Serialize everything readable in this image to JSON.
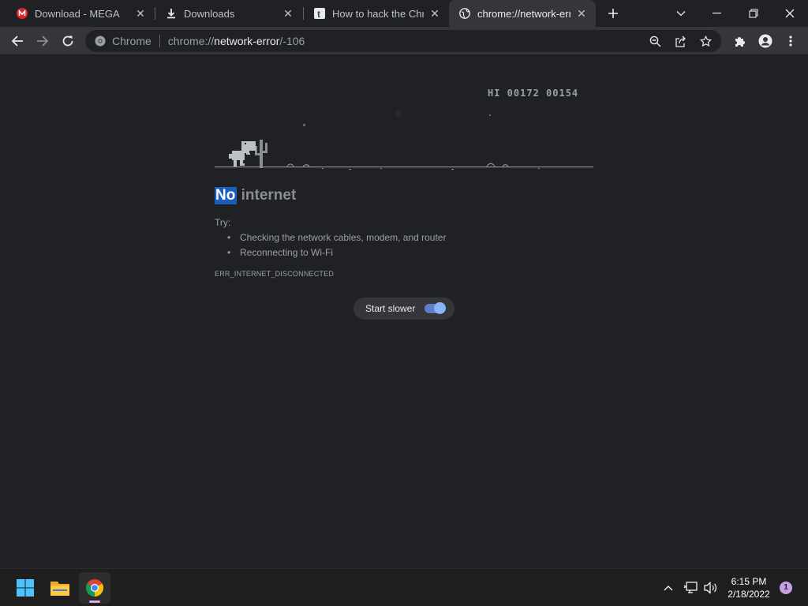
{
  "tabs": [
    {
      "title": "Download - MEGA",
      "favicon": "mega-icon"
    },
    {
      "title": "Downloads",
      "favicon": "download-icon"
    },
    {
      "title": "How to hack the Chron",
      "favicon": "tumblr-icon"
    },
    {
      "title": "chrome://network-erro",
      "favicon": "globe-icon",
      "active": true
    }
  ],
  "toolbar": {
    "chip_label": "Chrome",
    "url_scheme": "chrome://",
    "url_host": "network-error",
    "url_path": "/-106"
  },
  "game": {
    "hi_score": "HI 00172 00154"
  },
  "error": {
    "heading_highlight": "No",
    "heading_rest": "internet",
    "try_label": "Try:",
    "suggestions": [
      "Checking the network cables, modem, and router",
      "Reconnecting to Wi-Fi"
    ],
    "code": "ERR_INTERNET_DISCONNECTED"
  },
  "start_slower": {
    "label": "Start slower",
    "enabled": true
  },
  "taskbar": {
    "time": "6:15 PM",
    "date": "2/18/2022",
    "notification_count": "1"
  },
  "colors": {
    "accent": "#8ab4f8",
    "highlight": "#1a5fbf",
    "background": "#202124",
    "toolbar": "#35363a"
  }
}
